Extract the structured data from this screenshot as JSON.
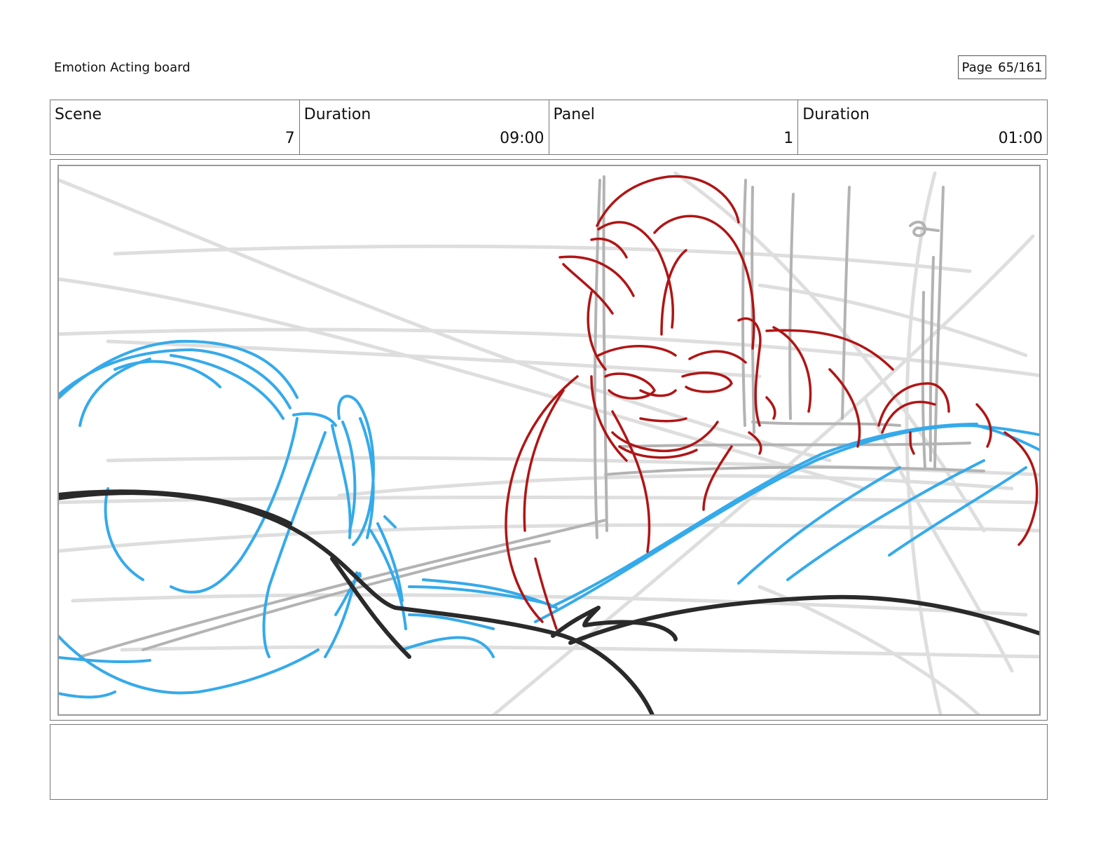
{
  "header": {
    "board_title": "Emotion Acting board",
    "page_label": "Page",
    "page_value": "65/161"
  },
  "info": {
    "scene_label": "Scene",
    "scene_value": "7",
    "scene_duration_label": "Duration",
    "scene_duration_value": "09:00",
    "panel_label": "Panel",
    "panel_value": "1",
    "panel_duration_label": "Duration",
    "panel_duration_value": "01:00"
  },
  "notes": {
    "text": ""
  },
  "colors": {
    "character_a": "#35aaea",
    "character_b": "#b01515",
    "ink": "#2a2a2a",
    "background_sketch": "#cfcfcf"
  }
}
